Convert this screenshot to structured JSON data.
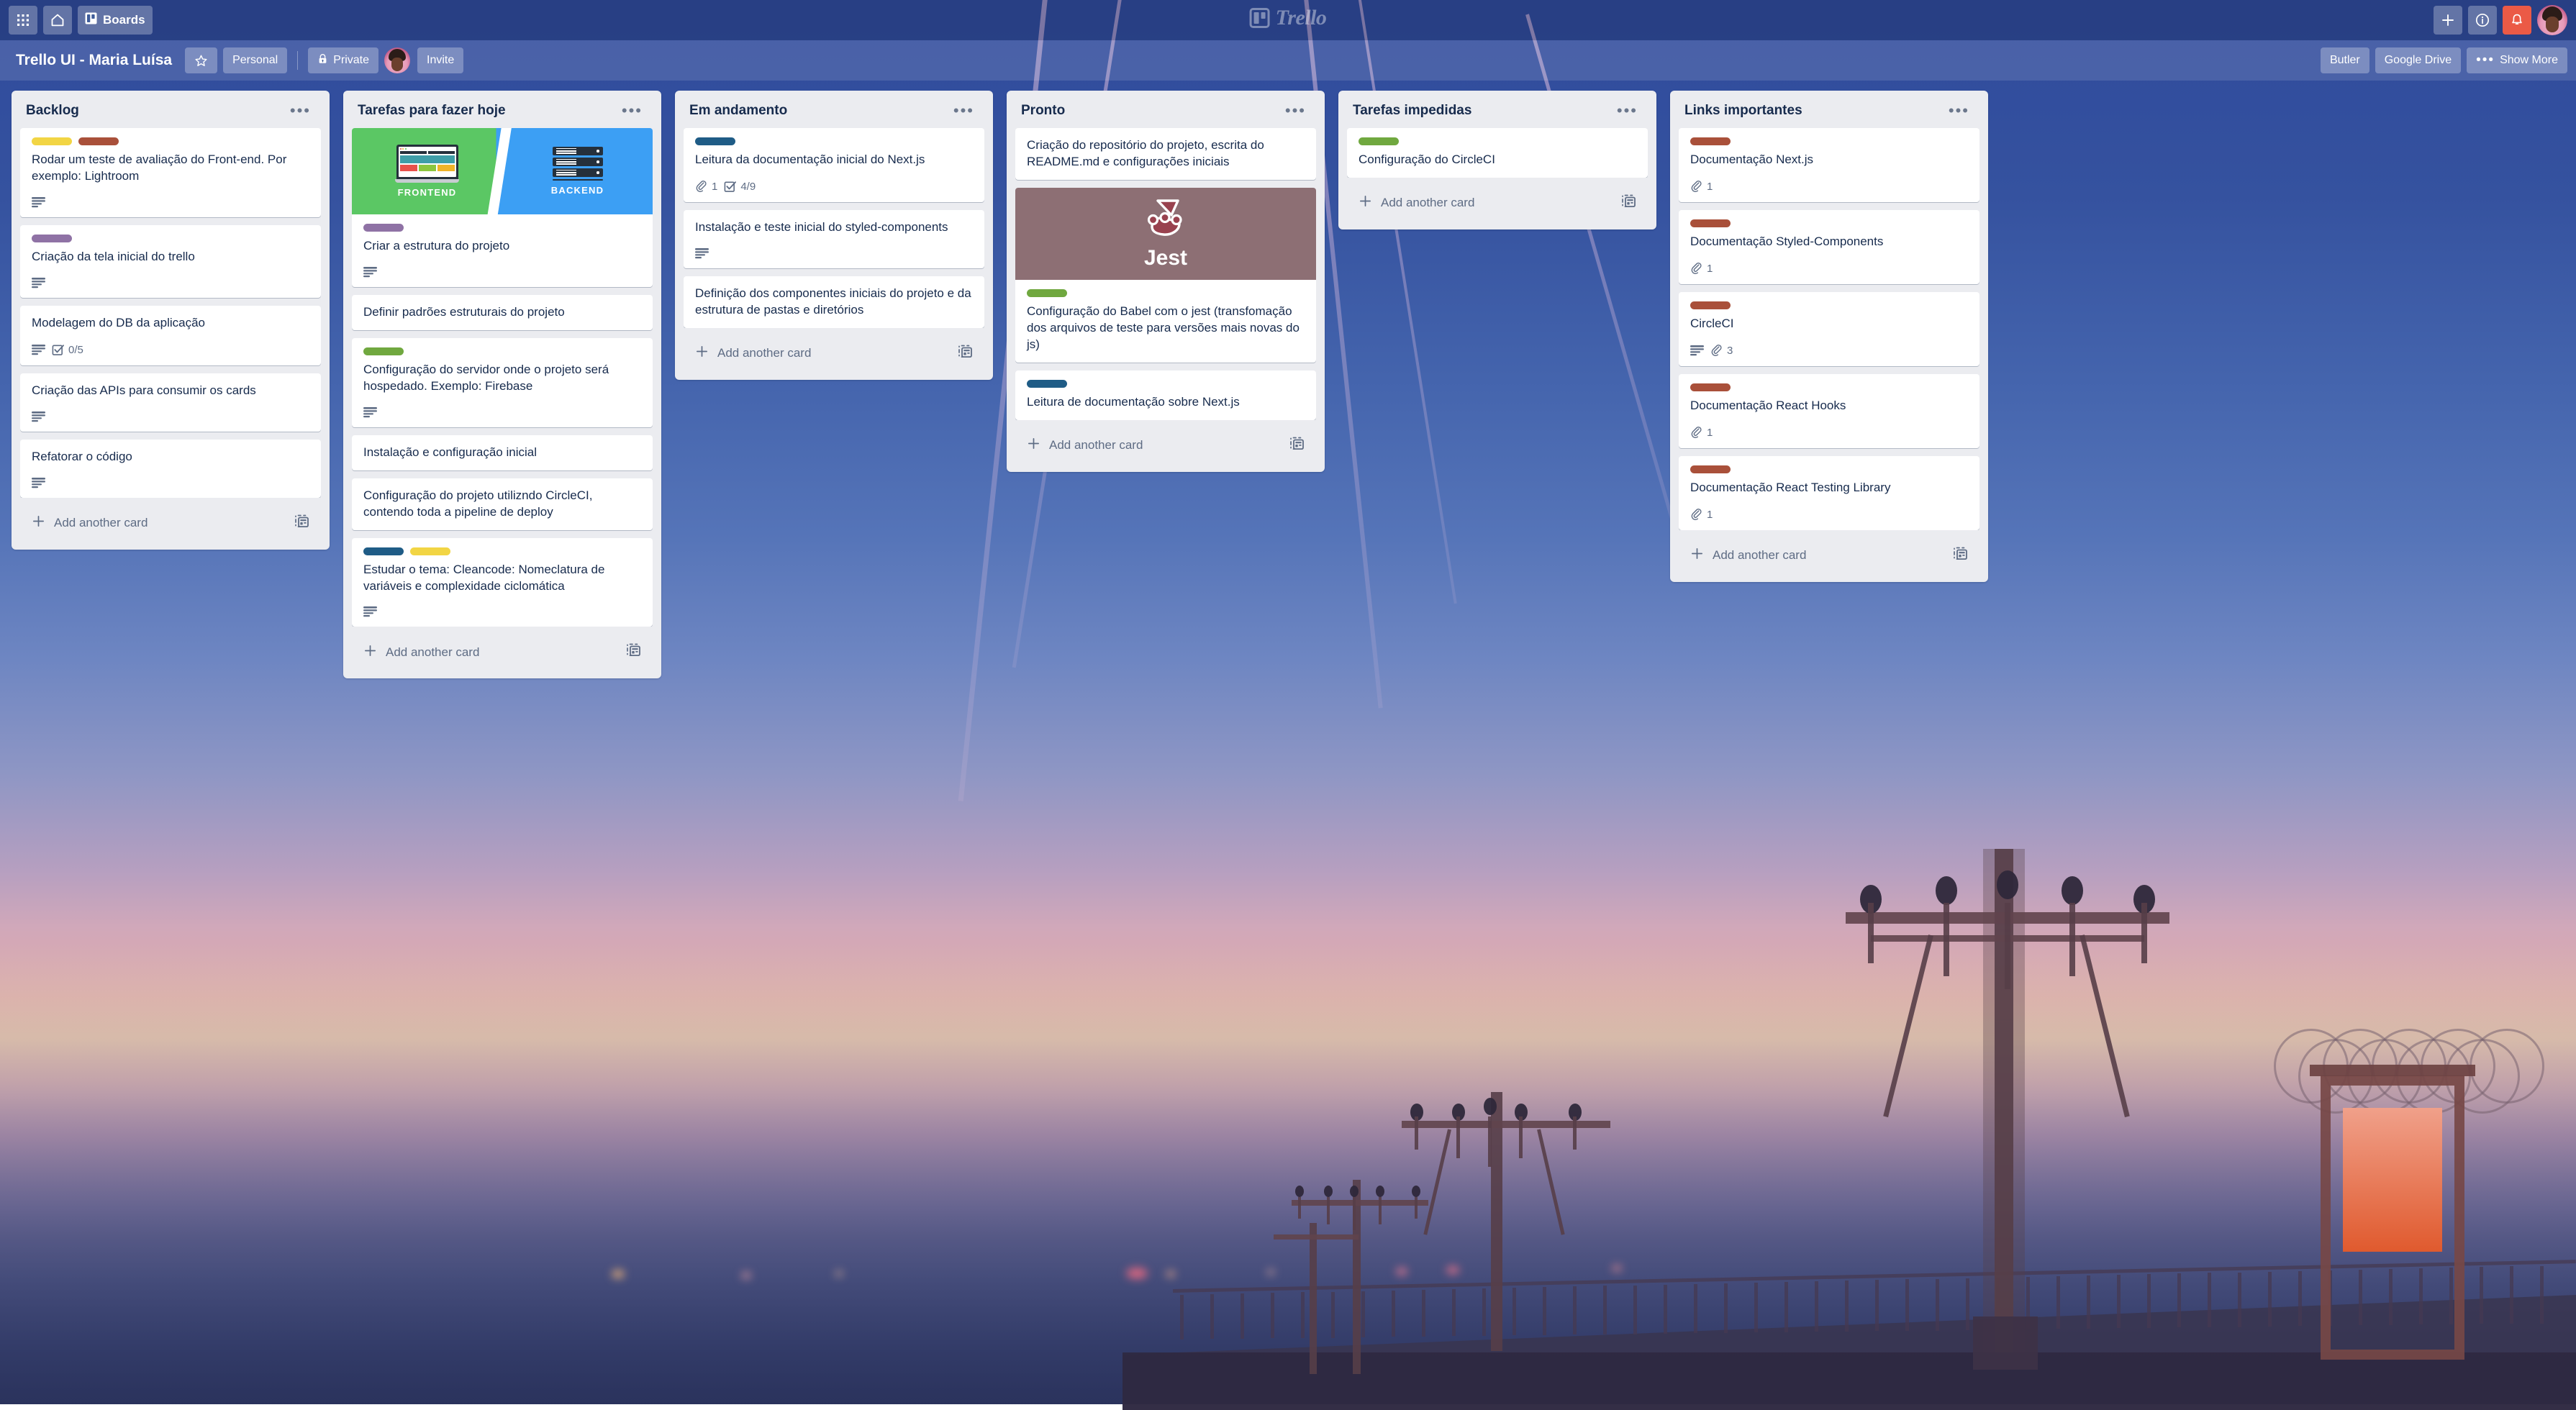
{
  "topbar": {
    "apps_icon": "grid-apps-icon",
    "home_icon": "home-icon",
    "boards_label": "Boards",
    "boards_icon": "board-icon",
    "add_icon": "plus-icon",
    "info_icon": "info-icon",
    "notification_icon": "bell-icon",
    "avatar_name": "user-avatar"
  },
  "logo": {
    "text": "Trello"
  },
  "boardbar": {
    "title": "Trello UI - Maria Luísa",
    "star_icon": "star-icon",
    "team_label": "Personal",
    "visibility_label": "Private",
    "visibility_icon": "lock-icon",
    "member_avatar": "board-member-avatar",
    "invite_label": "Invite",
    "butler_label": "Butler",
    "google_drive_label": "Google Drive",
    "show_more_label": "Show More",
    "show_more_icon": "ellipsis-icon"
  },
  "add_card_label": "Add another card",
  "label_colors": {
    "yellow": "#f2d544",
    "brown": "#a9503a",
    "purple": "#8f72a5",
    "green": "#70a83f",
    "blue": "#2b6288",
    "navy": "#1f5c86"
  },
  "lists": [
    {
      "title": "Backlog",
      "cards": [
        {
          "title": "Rodar um teste de avaliação do Front-end. Por exemplo: Lightroom",
          "labels": [
            "yellow",
            "brown"
          ],
          "badges": {
            "description": true
          }
        },
        {
          "title": "Criação da tela inicial do trello",
          "labels": [
            "purple"
          ],
          "badges": {
            "description": true
          }
        },
        {
          "title": "Modelagem do DB da aplicação",
          "labels": [],
          "badges": {
            "description": true,
            "checklist": "0/5"
          }
        },
        {
          "title": "Criação das APIs para consumir os cards",
          "labels": [],
          "badges": {
            "description": true
          }
        },
        {
          "title": "Refatorar o código",
          "labels": [],
          "badges": {
            "description": true
          }
        }
      ]
    },
    {
      "title": "Tarefas para fazer hoje",
      "cards": [
        {
          "title": "Criar a estrutura do projeto",
          "labels": [
            "purple"
          ],
          "cover": "frontend-backend",
          "cover_text": {
            "left": "FRONTEND",
            "right": "BACKEND"
          },
          "badges": {
            "description": true
          }
        },
        {
          "title": "Definir padrões estruturais do projeto",
          "labels": [],
          "badges": {}
        },
        {
          "title": "Configuração do servidor onde o projeto será hospedado. Exemplo: Firebase",
          "labels": [
            "green"
          ],
          "badges": {
            "description": true
          }
        },
        {
          "title": "Instalação e configuração inicial",
          "labels": [],
          "badges": {}
        },
        {
          "title": "Configuração do projeto utilizndo CircleCI, contendo toda a pipeline de deploy",
          "labels": [],
          "badges": {}
        },
        {
          "title": "Estudar o tema: Cleancode: Nomeclatura de variáveis e complexidade ciclomática",
          "labels": [
            "navy",
            "yellow"
          ],
          "badges": {
            "description": true
          }
        }
      ]
    },
    {
      "title": "Em andamento",
      "cards": [
        {
          "title": "Leitura da documentação inicial do Next.js",
          "labels": [
            "navy"
          ],
          "badges": {
            "attachments": "1",
            "checklist": "4/9"
          }
        },
        {
          "title": "Instalação e teste inicial do styled-components",
          "labels": [],
          "badges": {
            "description": true
          }
        },
        {
          "title": "Definição dos componentes iniciais do projeto e da estrutura de pastas e diretórios",
          "labels": [],
          "badges": {}
        }
      ]
    },
    {
      "title": "Pronto",
      "cards": [
        {
          "title": "Criação do repositório do projeto, escrita do README.md e configurações iniciais",
          "labels": [],
          "badges": {}
        },
        {
          "title": "Configuração do Babel com o jest (transfomação dos arquivos de teste para versões mais novas do js)",
          "labels": [
            "green"
          ],
          "cover": "jest",
          "cover_text": {
            "word": "Jest"
          },
          "badges": {}
        },
        {
          "title": "Leitura de documentação sobre Next.js",
          "labels": [
            "navy"
          ],
          "badges": {}
        }
      ]
    },
    {
      "title": "Tarefas impedidas",
      "cards": [
        {
          "title": "Configuração do CircleCI",
          "labels": [
            "green"
          ],
          "badges": {}
        }
      ]
    },
    {
      "title": "Links importantes",
      "cards": [
        {
          "title": "Documentação Next.js",
          "labels": [
            "brown"
          ],
          "badges": {
            "attachments": "1"
          }
        },
        {
          "title": "Documentação Styled-Components",
          "labels": [
            "brown"
          ],
          "badges": {
            "attachments": "1"
          }
        },
        {
          "title": "CircleCI",
          "labels": [
            "brown"
          ],
          "badges": {
            "description": true,
            "attachments": "3"
          }
        },
        {
          "title": "Documentação React Hooks",
          "labels": [
            "brown"
          ],
          "badges": {
            "attachments": "1"
          }
        },
        {
          "title": "Documentação React Testing Library",
          "labels": [
            "brown"
          ],
          "badges": {
            "attachments": "1"
          }
        }
      ]
    }
  ]
}
